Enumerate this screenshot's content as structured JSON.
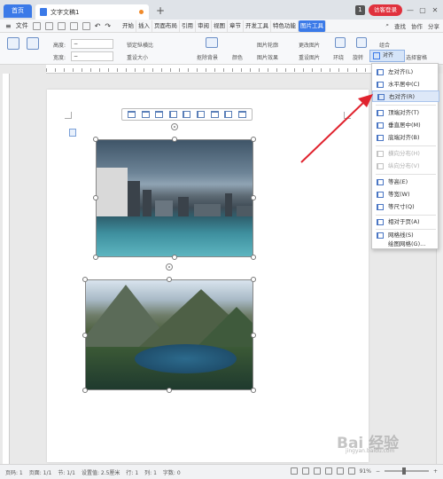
{
  "titlebar": {
    "home_tab": "首页",
    "document_tab": "文字文稿1",
    "new_tab": "+",
    "badge": "1",
    "login": "访客登录"
  },
  "menubar": {
    "file": "文件",
    "tabs": [
      "开始",
      "插入",
      "页面布局",
      "引用",
      "审阅",
      "视图",
      "章节",
      "开发工具",
      "特色功能",
      "图片工具"
    ],
    "active_tab": "图片工具",
    "search": "查找",
    "collaborate": "协作",
    "share": "分享"
  },
  "ribbon": {
    "height_label": "高度:",
    "width_label": "宽度:",
    "lock_ratio": "锁定纵横比",
    "reset_size": "重设大小",
    "remove_bg": "抠除背景",
    "color": "颜色",
    "picture_outline": "图片轮廓",
    "picture_effect": "图片效果",
    "change_picture": "更改图片",
    "reset_picture": "重设图片",
    "combine": "组合",
    "rotate": "旋转",
    "align": "对齐",
    "selection_pane": "选择窗格",
    "wrap": "环绕"
  },
  "dropdown": {
    "items": [
      {
        "label": "左对齐(L)",
        "enabled": true
      },
      {
        "label": "水平居中(C)",
        "enabled": true
      },
      {
        "label": "右对齐(R)",
        "enabled": true,
        "highlighted": true
      },
      {
        "label": "顶端对齐(T)",
        "enabled": true
      },
      {
        "label": "垂直居中(M)",
        "enabled": true
      },
      {
        "label": "底端对齐(B)",
        "enabled": true
      },
      {
        "label": "横向分布(H)",
        "enabled": false
      },
      {
        "label": "纵向分布(V)",
        "enabled": false
      },
      {
        "label": "等高(E)",
        "enabled": true
      },
      {
        "label": "等宽(W)",
        "enabled": true
      },
      {
        "label": "等尺寸(Q)",
        "enabled": true
      },
      {
        "label": "相对于页(A)",
        "enabled": true
      },
      {
        "label": "网格线(S)",
        "enabled": true
      },
      {
        "label": "绘图网格(G)...",
        "enabled": true
      }
    ]
  },
  "statusbar": {
    "page_no": "页码: 1",
    "page": "页面: 1/1",
    "section": "节: 1/1",
    "setting": "设置值: 2.5厘米",
    "row": "行: 1",
    "column": "列: 1",
    "words": "字数: 0",
    "zoom": "91%"
  },
  "watermark": {
    "text": "Bai 经验",
    "sub": "jingyan.baidu.com"
  },
  "colors": {
    "accent": "#3b7ae8",
    "login": "#e0313d",
    "arrow": "#e0232e"
  }
}
